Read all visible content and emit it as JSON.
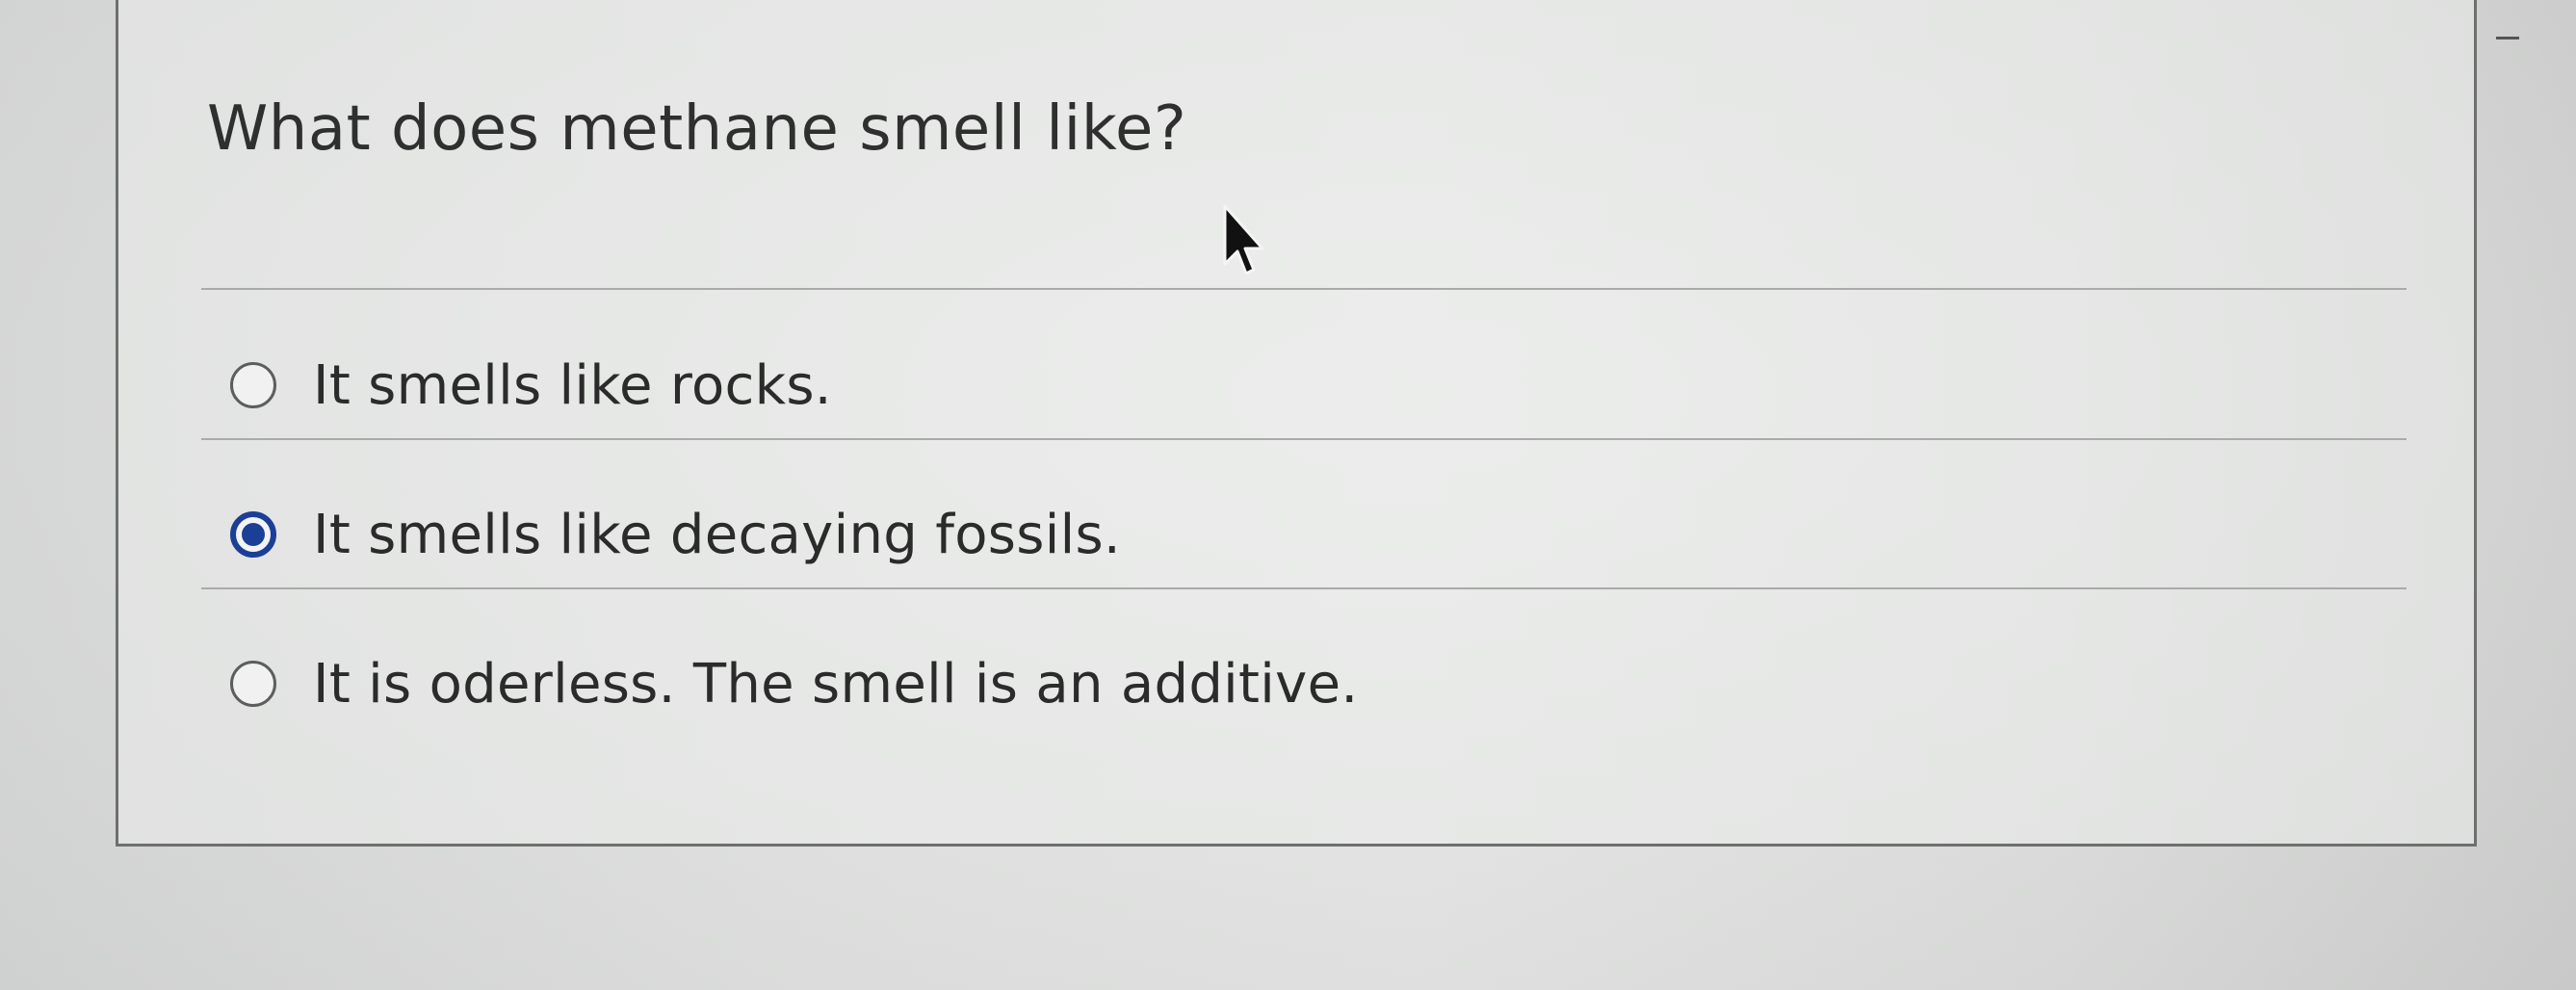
{
  "question": {
    "text": "What does methane smell like?"
  },
  "options": [
    {
      "label": "It smells like rocks.",
      "selected": false
    },
    {
      "label": "It smells like decaying fossils.",
      "selected": true
    },
    {
      "label": "It is oderless. The smell is an additive.",
      "selected": false
    }
  ],
  "colors": {
    "selected_radio": "#1b3f96",
    "card_border": "#6e6f6f"
  },
  "icons": {
    "pointer": "mouse-pointer-icon"
  }
}
